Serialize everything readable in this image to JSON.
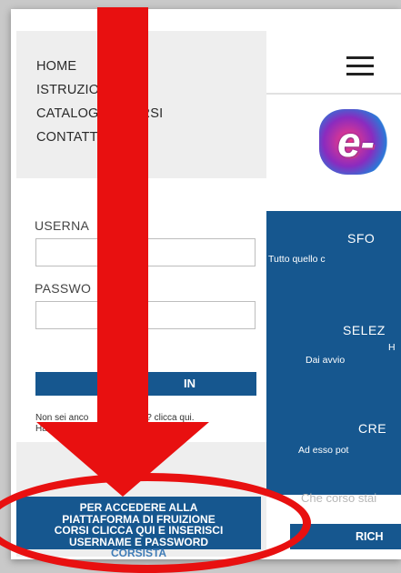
{
  "nav": {
    "items": [
      "HOME",
      "ISTRUZIO",
      "CATALOG",
      "RSI",
      "CONTATT"
    ]
  },
  "login": {
    "username_label": "USERNA",
    "password_label": "PASSWO",
    "login_button": "IN",
    "register_prefix": "Non sei anco",
    "register_suffix": "ato? clicca qui.",
    "forgot_prefix": "Hai dimentic",
    "forgot_suffix": "ssword?"
  },
  "access": {
    "line1": "PER ACCEDERE ALLA",
    "line2": "PIATTAFORMA DI FRUIZIONE",
    "line3": "CORSI CLICCA QUI E INSERISCI",
    "line4": "USERNAME E PASSWORD",
    "line5": "CORSISTA"
  },
  "main": {
    "logo": "e-",
    "panels": [
      {
        "title": "SFO",
        "desc": "Tutto quello c"
      },
      {
        "title": "SELEZ",
        "desc": "H"
      },
      {
        "title": "",
        "desc": "Dai avvio"
      },
      {
        "title": "CRE",
        "desc": "Ad esso pot"
      }
    ],
    "after_text": "Che corso stai",
    "request_button": "RICH"
  },
  "colors": {
    "primary": "#16578f",
    "annotation_red": "#e81010",
    "panel_gray": "#eeeeee"
  }
}
